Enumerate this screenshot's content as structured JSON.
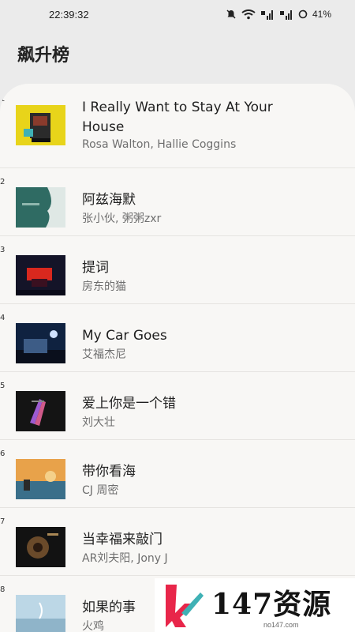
{
  "status_bar": {
    "time": "22:39:32",
    "battery": "41%"
  },
  "page": {
    "title": "飙升榜"
  },
  "songs": [
    {
      "rank": "1",
      "title": "I Really Want to Stay At Your House",
      "artist": "Rosa Walton, Hallie Coggins"
    },
    {
      "rank": "2",
      "title": "阿兹海默",
      "artist": "张小伙, 粥粥zxr"
    },
    {
      "rank": "3",
      "title": "提词",
      "artist": "房东的猫"
    },
    {
      "rank": "4",
      "title": "My Car Goes",
      "artist": "艾福杰尼"
    },
    {
      "rank": "5",
      "title": "爱上你是一个错",
      "artist": "刘大壮"
    },
    {
      "rank": "6",
      "title": "带你看海",
      "artist": "CJ 周密"
    },
    {
      "rank": "7",
      "title": "当幸福来敲门",
      "artist": "AR刘夫阳, Jony J"
    },
    {
      "rank": "8",
      "title": "如果的事",
      "artist": "火鸡"
    }
  ],
  "watermark": {
    "text": "147资源网",
    "domain": "no147.com"
  },
  "colors": {
    "accent_red": "#e8264a",
    "accent_teal": "#3fb1b5",
    "sheet": "#f8f7f5",
    "background": "#ebebeb"
  }
}
